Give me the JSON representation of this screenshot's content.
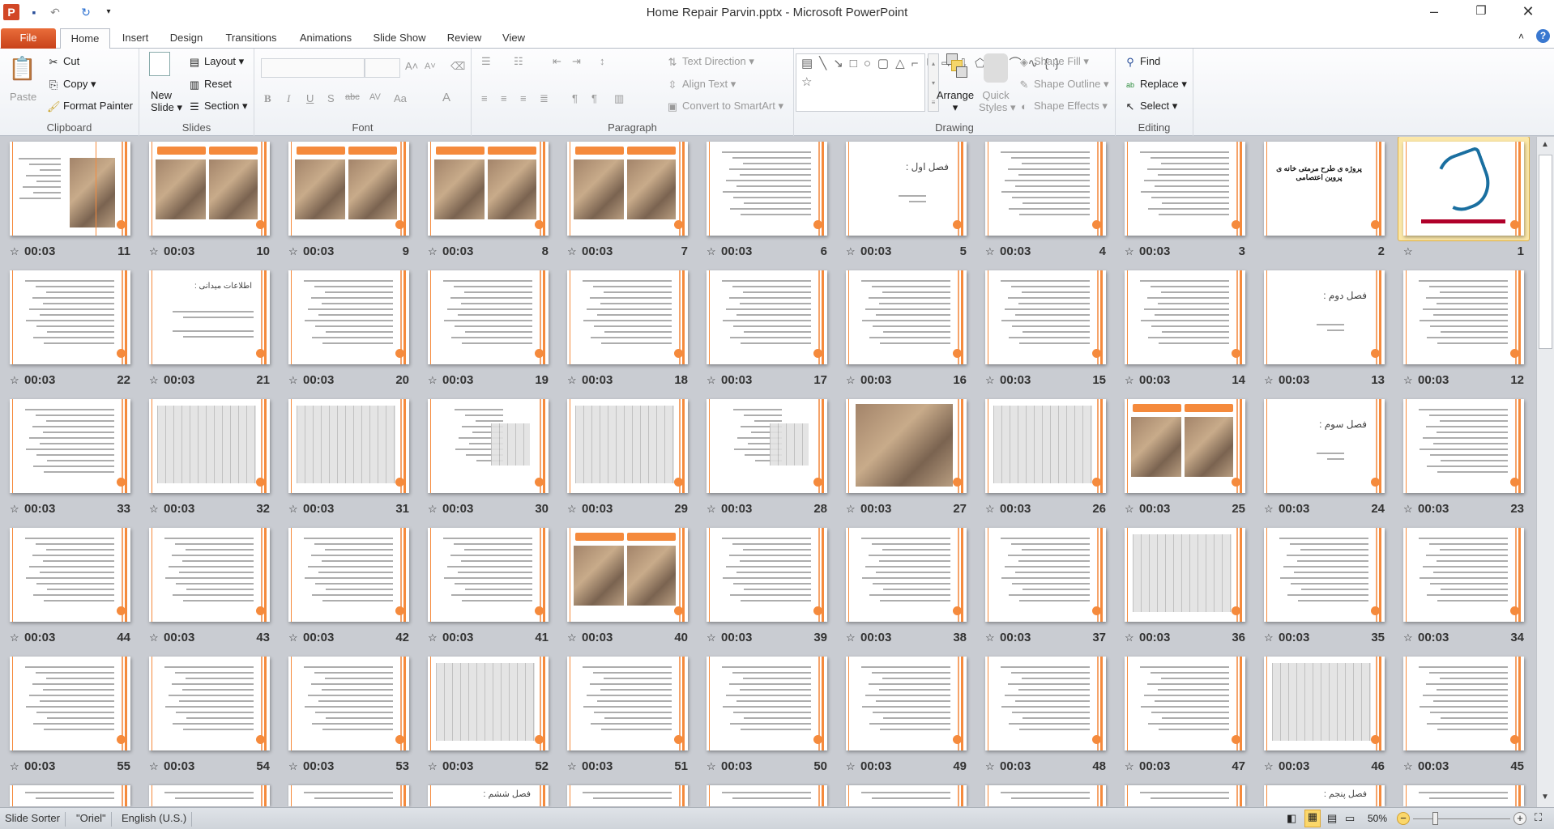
{
  "window": {
    "title": "Home Repair Parvin.pptx - Microsoft PowerPoint"
  },
  "quick_access": {
    "icons": [
      "powerpoint-icon",
      "save-icon",
      "undo-icon",
      "redo-icon",
      "customize-icon"
    ]
  },
  "tabs": [
    {
      "label": "File"
    },
    {
      "label": "Home"
    },
    {
      "label": "Insert"
    },
    {
      "label": "Design"
    },
    {
      "label": "Transitions"
    },
    {
      "label": "Animations"
    },
    {
      "label": "Slide Show"
    },
    {
      "label": "Review"
    },
    {
      "label": "View"
    }
  ],
  "ribbon": {
    "clipboard": {
      "label": "Clipboard",
      "paste": "Paste",
      "cut": "Cut",
      "copy": "Copy",
      "format_painter": "Format Painter"
    },
    "slides": {
      "label": "Slides",
      "new_slide_1": "New",
      "new_slide_2": "Slide",
      "layout": "Layout",
      "reset": "Reset",
      "section": "Section"
    },
    "font": {
      "label": "Font",
      "font_name": "",
      "font_size": ""
    },
    "paragraph": {
      "label": "Paragraph",
      "text_direction": "Text Direction",
      "align_text": "Align Text",
      "convert_smartart": "Convert to SmartArt"
    },
    "drawing": {
      "label": "Drawing",
      "arrange": "Arrange",
      "quick_styles_1": "Quick",
      "quick_styles_2": "Styles",
      "shape_fill": "Shape Fill",
      "shape_outline": "Shape Outline",
      "shape_effects": "Shape Effects"
    },
    "editing": {
      "label": "Editing",
      "find": "Find",
      "replace": "Replace",
      "select": "Select"
    }
  },
  "slides": [
    {
      "n": "1",
      "type": "logo",
      "time": "",
      "selected": true
    },
    {
      "n": "2",
      "type": "titleslide",
      "time": "",
      "no_icon": true,
      "title": "پروژه ی طرح مرمتی خانه ی پروین اعتصامی"
    },
    {
      "n": "3",
      "type": "text",
      "time": "00:03"
    },
    {
      "n": "4",
      "type": "text",
      "time": "00:03"
    },
    {
      "n": "5",
      "type": "section",
      "time": "00:03",
      "title": "فصل اول :"
    },
    {
      "n": "6",
      "type": "text",
      "time": "00:03"
    },
    {
      "n": "7",
      "type": "photo2",
      "time": "00:03"
    },
    {
      "n": "8",
      "type": "photo2",
      "time": "00:03"
    },
    {
      "n": "9",
      "type": "photo2",
      "time": "00:03"
    },
    {
      "n": "10",
      "type": "photo2",
      "time": "00:03"
    },
    {
      "n": "11",
      "type": "phototext",
      "time": "00:03"
    },
    {
      "n": "12",
      "type": "text",
      "time": "00:03"
    },
    {
      "n": "13",
      "type": "section",
      "time": "00:03",
      "title": "فصل دوم :"
    },
    {
      "n": "14",
      "type": "text",
      "time": "00:03"
    },
    {
      "n": "15",
      "type": "text",
      "time": "00:03"
    },
    {
      "n": "16",
      "type": "text",
      "time": "00:03"
    },
    {
      "n": "17",
      "type": "text",
      "time": "00:03"
    },
    {
      "n": "18",
      "type": "text",
      "time": "00:03"
    },
    {
      "n": "19",
      "type": "text",
      "time": "00:03"
    },
    {
      "n": "20",
      "type": "text",
      "time": "00:03"
    },
    {
      "n": "21",
      "type": "text",
      "time": "00:03",
      "title": "اطلاعات میدانی :"
    },
    {
      "n": "22",
      "type": "text",
      "time": "00:03"
    },
    {
      "n": "23",
      "type": "text",
      "time": "00:03"
    },
    {
      "n": "24",
      "type": "section",
      "time": "00:03",
      "title": "فصل سوم :"
    },
    {
      "n": "25",
      "type": "photo2",
      "time": "00:03"
    },
    {
      "n": "26",
      "type": "plan",
      "time": "00:03"
    },
    {
      "n": "27",
      "type": "photo",
      "time": "00:03"
    },
    {
      "n": "28",
      "type": "plantext",
      "time": "00:03"
    },
    {
      "n": "29",
      "type": "plan",
      "time": "00:03"
    },
    {
      "n": "30",
      "type": "plantext",
      "time": "00:03"
    },
    {
      "n": "31",
      "type": "plan",
      "time": "00:03"
    },
    {
      "n": "32",
      "type": "plan",
      "time": "00:03"
    },
    {
      "n": "33",
      "type": "text",
      "time": "00:03"
    },
    {
      "n": "34",
      "type": "text",
      "time": "00:03"
    },
    {
      "n": "35",
      "type": "text",
      "time": "00:03"
    },
    {
      "n": "36",
      "type": "plan",
      "time": "00:03"
    },
    {
      "n": "37",
      "type": "text",
      "time": "00:03"
    },
    {
      "n": "38",
      "type": "text",
      "time": "00:03"
    },
    {
      "n": "39",
      "type": "text",
      "time": "00:03"
    },
    {
      "n": "40",
      "type": "photo2",
      "time": "00:03"
    },
    {
      "n": "41",
      "type": "text",
      "time": "00:03"
    },
    {
      "n": "42",
      "type": "text",
      "time": "00:03"
    },
    {
      "n": "43",
      "type": "text",
      "time": "00:03"
    },
    {
      "n": "44",
      "type": "text",
      "time": "00:03"
    },
    {
      "n": "45",
      "type": "text",
      "time": "00:03"
    },
    {
      "n": "46",
      "type": "plan",
      "time": "00:03"
    },
    {
      "n": "47",
      "type": "text",
      "time": "00:03"
    },
    {
      "n": "48",
      "type": "text",
      "time": "00:03"
    },
    {
      "n": "49",
      "type": "text",
      "time": "00:03"
    },
    {
      "n": "50",
      "type": "text",
      "time": "00:03"
    },
    {
      "n": "51",
      "type": "text",
      "time": "00:03"
    },
    {
      "n": "52",
      "type": "plan",
      "time": "00:03"
    },
    {
      "n": "53",
      "type": "text",
      "time": "00:03"
    },
    {
      "n": "54",
      "type": "text",
      "time": "00:03"
    },
    {
      "n": "55",
      "type": "text",
      "time": "00:03"
    },
    {
      "n": "",
      "type": "text",
      "time": ""
    },
    {
      "n": "",
      "type": "section",
      "time": "",
      "title": "فصل پنجم :"
    },
    {
      "n": "",
      "type": "text",
      "time": ""
    },
    {
      "n": "",
      "type": "text",
      "time": ""
    },
    {
      "n": "",
      "type": "text",
      "time": ""
    },
    {
      "n": "",
      "type": "text",
      "time": ""
    },
    {
      "n": "",
      "type": "text",
      "time": ""
    },
    {
      "n": "",
      "type": "section",
      "time": "",
      "title": "فصل ششم :"
    },
    {
      "n": "",
      "type": "text",
      "time": ""
    },
    {
      "n": "",
      "type": "text",
      "time": ""
    },
    {
      "n": "",
      "type": "text",
      "time": ""
    }
  ],
  "status": {
    "view": "Slide Sorter",
    "theme": "\"Oriel\"",
    "language": "English (U.S.)",
    "zoom": "50%"
  },
  "colors": {
    "accent": "#f58a3c",
    "selection": "#f0c85a",
    "file_tab": "#d8522a"
  }
}
